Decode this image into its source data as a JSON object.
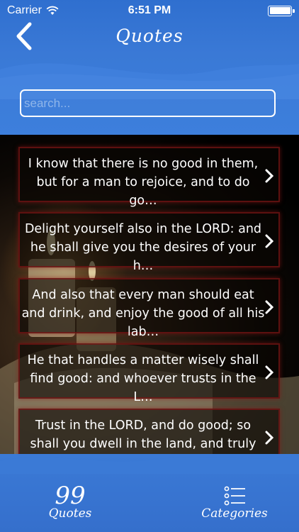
{
  "status_bar": {
    "carrier": "Carrier",
    "time": "6:51 PM"
  },
  "navbar": {
    "title": "Quotes"
  },
  "search": {
    "placeholder": "search..."
  },
  "quotes": [
    "I know that there is no good in them, but for a man to rejoice, and to do go…",
    "Delight yourself also in the LORD: and he shall give you the desires of your h…",
    "And also that every man should eat and drink, and enjoy the good of all his lab…",
    "He that handles a matter wisely shall find good: and whoever trusts in the L…",
    "Trust in the LORD, and do good; so shall you dwell in the land, and truly you sh…"
  ],
  "tabs": {
    "quotes": {
      "glyph": "99",
      "label": "Quotes"
    },
    "categories": {
      "label": "Categories"
    }
  },
  "colors": {
    "accent_blue": "#3a79d6",
    "item_border": "#7a1414"
  },
  "icons": [
    "wifi-icon",
    "battery-icon",
    "back-chevron-icon",
    "chevron-right-icon",
    "quote-icon",
    "list-icon"
  ]
}
